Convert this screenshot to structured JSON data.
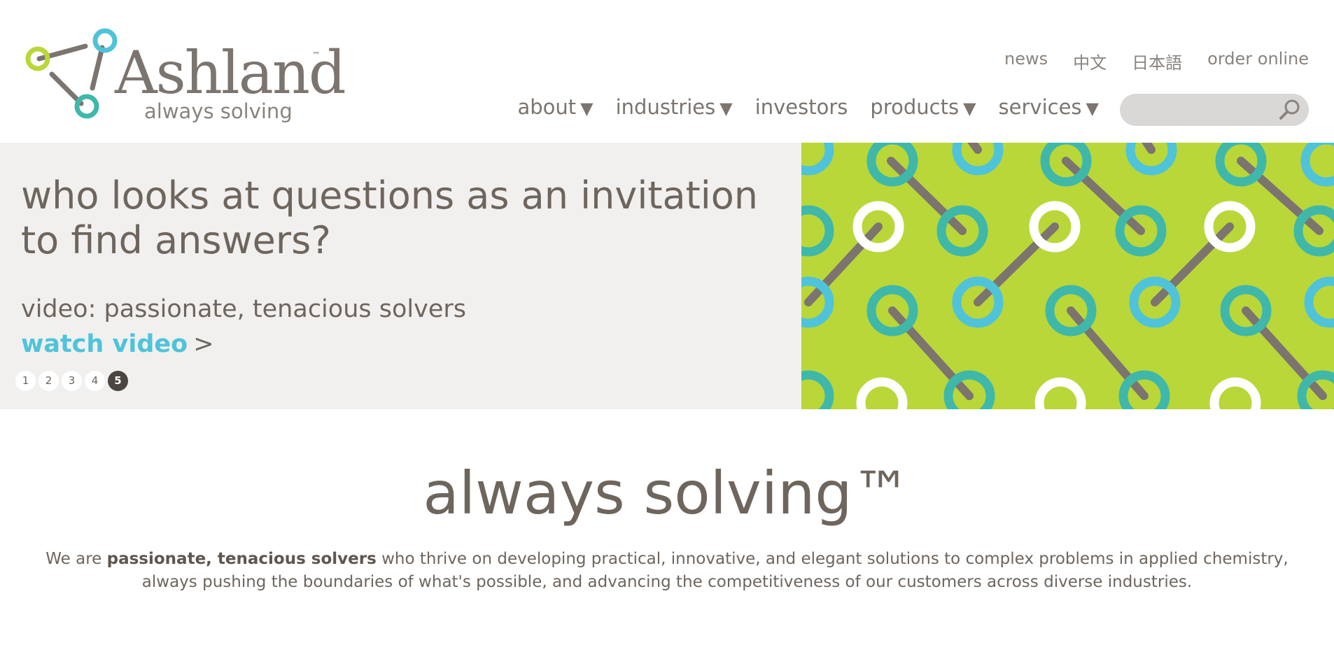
{
  "brand": {
    "name": "Ashland",
    "tm": "™",
    "tagline": "always solving",
    "colors": {
      "lime": "#b9d739",
      "teal": "#3fb8aa",
      "cyan": "#4fc3d9",
      "gray": "#7c746e"
    }
  },
  "utility_nav": [
    {
      "label": "news"
    },
    {
      "label": "中文"
    },
    {
      "label": "日本語"
    },
    {
      "label": "order online"
    }
  ],
  "main_nav": [
    {
      "label": "about",
      "caret": "▼"
    },
    {
      "label": "industries",
      "caret": "▼"
    },
    {
      "label": "investors",
      "caret": ""
    },
    {
      "label": "products",
      "caret": "▼"
    },
    {
      "label": "services",
      "caret": "▼"
    }
  ],
  "search": {
    "placeholder": "",
    "icon": "search-icon"
  },
  "hero": {
    "headline": "who looks at questions as an invitation to find answers?",
    "subhead": "video: passionate, tenacious solvers",
    "cta_label": "watch video",
    "cta_arrow": ">",
    "slides": [
      "1",
      "2",
      "3",
      "4",
      "5"
    ],
    "active_slide": "5"
  },
  "intro": {
    "title": "always solving™",
    "body_prefix": "We are ",
    "body_bold": "passionate, tenacious solvers",
    "body_rest": " who thrive on developing practical, innovative, and elegant solutions to complex problems in applied chemistry, always pushing the boundaries of what's possible, and advancing the competitiveness of our customers across diverse industries."
  }
}
